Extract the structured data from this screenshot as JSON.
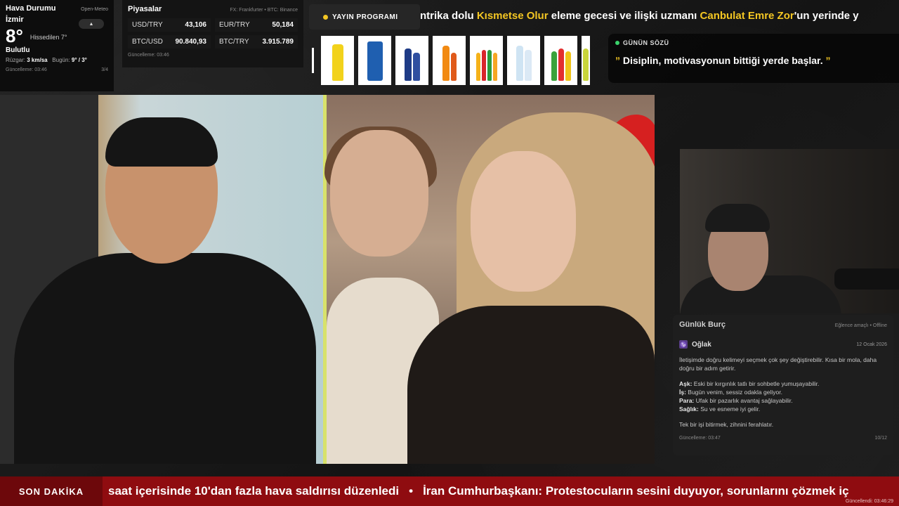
{
  "weather": {
    "title": "Hava Durumu",
    "source": "Open-Meteo",
    "city": "İzmir",
    "toggle_glyph": "▲",
    "temperature": "8°",
    "feels_like": "Hissedilen 7°",
    "condition": "Bulutlu",
    "wind_label": "Rüzgar:",
    "wind_value": "3 km/sa",
    "today_label": "Bugün:",
    "today_value": "9° / 3°",
    "updated": "Güncelleme: 03:46",
    "page": "3/4"
  },
  "markets": {
    "title": "Piyasalar",
    "source": "FX: Frankfurter • BTC: Binance",
    "rows": [
      {
        "key": "USD/TRY",
        "value": "43,106"
      },
      {
        "key": "EUR/TRY",
        "value": "50,184"
      },
      {
        "key": "BTC/USD",
        "value": "90.840,93"
      },
      {
        "key": "BTC/TRY",
        "value": "3.915.789"
      }
    ],
    "updated": "Güncelleme: 03:46"
  },
  "schedule": {
    "label": "YAYIN PROGRAMI",
    "marquee_before": "ntrika dolu ",
    "marquee_show": "Kısmetse Olur",
    "marquee_middle": " eleme gecesi ve ilişki uzmanı ",
    "marquee_person": "Canbulat Emre Zor",
    "marquee_after": "'un yerinde y"
  },
  "quote": {
    "label": "GÜNÜN SÖZÜ",
    "open_mark": "”",
    "text": " Disiplin, motivasyonun bittiği yerde başlar. ",
    "close_mark": "”"
  },
  "horoscope": {
    "title": "Günlük Burç",
    "meta": "Eğlence amaçlı • Offline",
    "sign_icon": "♑",
    "sign": "Oğlak",
    "date": "12 Ocak 2026",
    "intro": "İletişimde doğru kelimeyi seçmek çok şey değiştirebilir. Kısa bir mola, daha doğru bir adım getirir.",
    "rows": [
      {
        "label": "Aşk:",
        "text": " Eski bir kırgınlık tatlı bir sohbetle yumuşayabilir."
      },
      {
        "label": "İş:",
        "text": " Bugün venim, sessiz odakla geliyor."
      },
      {
        "label": "Para:",
        "text": " Ufak bir pazarlık avantaj sağlayabilir."
      },
      {
        "label": "Sağlık:",
        "text": " Su ve esneme iyi gelir."
      }
    ],
    "tip": "Tek bir işi bitirmek, zihnini ferahlatır.",
    "updated": "Güncelleme: 03:47",
    "page": "10/12"
  },
  "news": {
    "label": "SON DAKİKA",
    "item1": "saat içerisinde 10'dan fazla hava saldırısı düzenledi",
    "separator": "•",
    "item2": "İran Cumhurbaşkanı: Protestocuların sesini duyuyor, sorunlarını çözmek iç",
    "updated": "Güncellendi: 03:46:29"
  },
  "colors": {
    "accent_yellow": "#f3c623",
    "news_red": "#8f0c10",
    "live_green": "#3ad36b"
  }
}
